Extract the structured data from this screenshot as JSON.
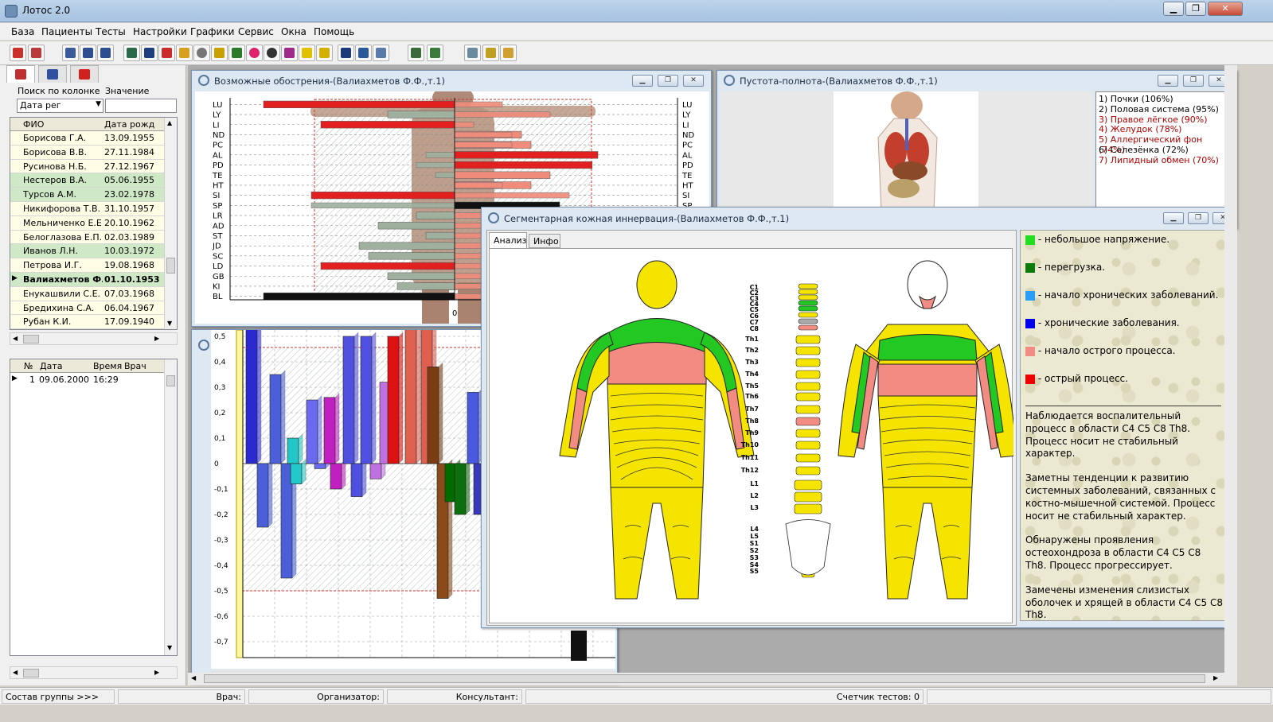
{
  "app": {
    "title": "Лотос 2.0",
    "minimize": "▁",
    "restore": "❐",
    "close": "✕"
  },
  "menu": [
    "База",
    "Пациенты",
    "Тесты",
    "Настройки",
    "Графики",
    "Сервис",
    "Окна",
    "Помощь"
  ],
  "left": {
    "search_col_label": "Поиск по колонке",
    "value_label": "Значение",
    "search_col_value": "Дата рег",
    "patients_headers": [
      "ФИО",
      "Дата рожд"
    ],
    "patients": [
      {
        "name": "Борисова Г.А.",
        "dob": "13.09.1955"
      },
      {
        "name": "Борисова В.В.",
        "dob": "27.11.1984"
      },
      {
        "name": "Русинова Н.Б.",
        "dob": "27.12.1967"
      },
      {
        "name": "Нестеров В.А.",
        "dob": "05.06.1955"
      },
      {
        "name": "Турсов А.М.",
        "dob": "23.02.1978"
      },
      {
        "name": "Никифорова Т.В.",
        "dob": "31.10.1957"
      },
      {
        "name": "Мельниченко Е.Е.",
        "dob": "20.10.1962"
      },
      {
        "name": "Белоглазова Е.П.",
        "dob": "02.03.1989"
      },
      {
        "name": "Иванов Л.Н.",
        "dob": "10.03.1972"
      },
      {
        "name": "Петрова И.Г.",
        "dob": "19.08.1968"
      },
      {
        "name": "Валиахметов Ф.Ф.",
        "dob": "01.10.1953"
      },
      {
        "name": "Енукашвили С.Е.",
        "dob": "07.03.1968"
      },
      {
        "name": "Бредихина С.А.",
        "dob": "06.04.1967"
      },
      {
        "name": "Рубан К.И.",
        "dob": "17.09.1940"
      }
    ],
    "visits_headers": [
      "№",
      "Дата",
      "Время",
      "Врач"
    ],
    "visits": [
      {
        "n": "1",
        "date": "09.06.2000",
        "time": "16:29",
        "doctor": ""
      }
    ]
  },
  "win_exacerbation": {
    "title": "Возможные обострения-(Валиахметов Ф.Ф.,т.1)",
    "zero_label": "0"
  },
  "win_emptiness": {
    "title": "Пустота-полнота-(Валиахметов Ф.Ф.,т.1)",
    "items": [
      {
        "text": "1) Почки (106%)",
        "color": "#000000"
      },
      {
        "text": "2) Половая система (95%)",
        "color": "#000000"
      },
      {
        "text": "3) Правое лёгкое (90%)",
        "color": "#b00000"
      },
      {
        "text": "4) Желудок (78%)",
        "color": "#b00000"
      },
      {
        "text": "5) Аллергический фон (74%)",
        "color": "#b00000"
      },
      {
        "text": "6) Селезёнка (72%)",
        "color": "#000000"
      },
      {
        "text": "7) Липидный обмен (70%)",
        "color": "#b00000"
      }
    ]
  },
  "win_segment": {
    "title": "Сегментарная кожная иннервация-(Валиахметов Ф.Ф.,т.1)",
    "tabs": [
      "Анализ",
      "Инфо"
    ],
    "legend": [
      {
        "color": "#22dd22",
        "text": " - небольшое напряжение."
      },
      {
        "color": "#0a7a0a",
        "text": " - перегрузка."
      },
      {
        "color": "#2a9df4",
        "text": " - начало хронических заболеваний."
      },
      {
        "color": "#0000ee",
        "text": " - хронические заболевания."
      },
      {
        "color": "#f28b82",
        "text": " - начало острого процесса."
      },
      {
        "color": "#ee0000",
        "text": " - острый процесс."
      }
    ],
    "observations": [
      "Наблюдается воспалительный процесс в области  С4 С5 С8 Th8. Процесс носит не стабильный характер.",
      "Заметны тенденции к  развитию системных заболеваний, связанных с костно-мышечной системой.  Процесс носит не стабильный характер.",
      "Обнаружены проявления остеохондроза  в области  С4 С5 С8 Th8. Процесс прогрессирует.",
      "Замечены изменения слизистых оболочек и хрящей в области  С4 С5 С8 Th8."
    ],
    "spine_labels": [
      "C1",
      "C2",
      "C3",
      "C4",
      "C5",
      "C6",
      "C7",
      "C8",
      "Th1",
      "Th2",
      "Th3",
      "Th4",
      "Th5",
      "Th6",
      "Th7",
      "Th8",
      "Th9",
      "Th10",
      "Th11",
      "Th12",
      "L1",
      "L2",
      "L3",
      "L4",
      "L5",
      "S1",
      "S2",
      "S3",
      "S4",
      "S5"
    ]
  },
  "chart_data": [
    {
      "type": "bar",
      "orientation": "horizontal",
      "categories": [
        "LU",
        "LY",
        "LI",
        "ND",
        "PC",
        "AL",
        "PD",
        "TE",
        "HT",
        "SI",
        "SP",
        "LR",
        "AD",
        "ST",
        "JD",
        "SC",
        "LD",
        "GB",
        "KI",
        "BL"
      ],
      "series": [
        {
          "values": [
            -1.0,
            -0.35,
            -0.7,
            0.35,
            0.4,
            0.75,
            0.72,
            0.5,
            0.4,
            -0.75,
            0.55,
            -0.2,
            -0.4,
            -0.15,
            -0.5,
            -0.45,
            -0.7,
            -0.35,
            -0.3,
            -1.0
          ]
        },
        {
          "values": [
            0.25,
            0.5,
            0.1,
            0.3,
            0.3,
            -0.15,
            -0.2,
            -0.1,
            0.25,
            0.6,
            -0.75,
            0.15,
            0.2,
            0.3,
            0.2,
            0.3,
            0.3,
            0.2,
            0.3,
            0.3
          ]
        }
      ]
    },
    {
      "type": "bar",
      "ylim": [
        -0.75,
        0.55
      ],
      "yticks": [
        "0,5",
        "0,4",
        "0,3",
        "0,2",
        "0,1",
        "0",
        "-0,1",
        "-0,2",
        "-0,3",
        "-0,4",
        "-0,5",
        "-0,6",
        "-0,7"
      ],
      "values": [
        0.55,
        -0.25,
        0.35,
        -0.45,
        0.1,
        -0.08,
        0.25,
        -0.02,
        0.26,
        -0.1,
        0.5,
        -0.13,
        0.5,
        -0.06,
        0.32,
        0.5,
        0.0,
        0.53,
        0.0,
        0.55,
        0.38,
        -0.53,
        -0.15,
        -0.2,
        0.28,
        -0.2,
        0.1
      ],
      "colors": [
        "#2a2ad0",
        "#4b5fd8",
        "#4b5fd8",
        "#4b5fd8",
        "#22c7c7",
        "#22c7c7",
        "#6a6af0",
        "#6a6af0",
        "#c020c0",
        "#c020c0",
        "#5050e0",
        "#5050e0",
        "#5050e0",
        "#c070e0",
        "#c070e0",
        "#dd1111",
        "#dd1111",
        "#e06050",
        "#e06050",
        "#e06050",
        "#7a3e12",
        "#8a4a1a",
        "#006b00",
        "#0d6e0d",
        "#4a5ae0",
        "#3838b8",
        "#7a6a4a"
      ]
    }
  ]
}
